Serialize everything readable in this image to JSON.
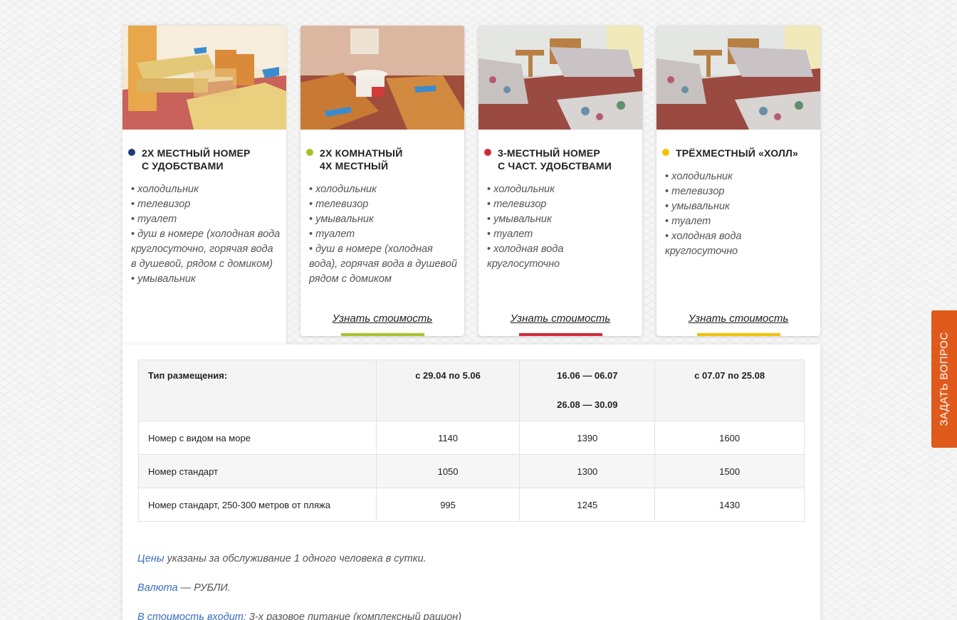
{
  "rooms": [
    {
      "title": "2х местный номер\nс удобствами",
      "dot_color": "#1a3e7e",
      "features": [
        "холодильник",
        "телевизор",
        "туалет",
        "душ в номере (холодная вода круглосуточно, горячая вода в душевой, рядом с домиком)",
        "умывальник"
      ],
      "link": "",
      "bar_color": ""
    },
    {
      "title": "2х комнатный\n4х местный",
      "dot_color": "#a5c42a",
      "features": [
        "холодильник",
        "телевизор",
        "умывальник",
        "туалет",
        "душ в номере (холодная вода), горячая вода в душевой рядом с домиком"
      ],
      "link": "Узнать стоимость",
      "bar_color": "#a5c42a"
    },
    {
      "title": "3-местный номер\nс част. удобствами",
      "dot_color": "#d32b36",
      "features": [
        "холодильник",
        "телевизор",
        "умывальник",
        "туалет",
        "холодная вода круглосуточно"
      ],
      "link": "Узнать стоимость",
      "bar_color": "#d32b36"
    },
    {
      "title": "Трёхместный «холл»",
      "dot_color": "#f2c200",
      "features": [
        "холодильник",
        "телевизор",
        "умывальник",
        "туалет",
        "холодная вода круглосуточно"
      ],
      "link": "Узнать стоимость",
      "bar_color": "#f2c200"
    }
  ],
  "table": {
    "header": {
      "type": "Тип размещения:",
      "col1": "с 29.04 по  5.06",
      "col2_line1": "16.06 — 06.07",
      "col2_line2": "26.08 — 30.09",
      "col3": "с 07.07 по 25.08"
    },
    "rows": [
      {
        "name": "Номер с видом на море",
        "p1": "1140",
        "p2": "1390",
        "p3": "1600"
      },
      {
        "name": "Номер стандарт",
        "p1": "1050",
        "p2": "1300",
        "p3": "1500"
      },
      {
        "name": "Номер стандарт, 250-300 метров от пляжа",
        "p1": "995",
        "p2": "1245",
        "p3": "1430"
      }
    ]
  },
  "notes": [
    {
      "label": "Цены",
      "text": " указаны за обслуживание 1 одного человека в сутки."
    },
    {
      "label": "Валюта",
      "text": " — РУБЛИ."
    },
    {
      "label": "В стоимость входит:",
      "text": " 3-х разовое питание (комплексный рацион)"
    }
  ],
  "ask_button": "ЗАДАТЬ ВОПРОС"
}
